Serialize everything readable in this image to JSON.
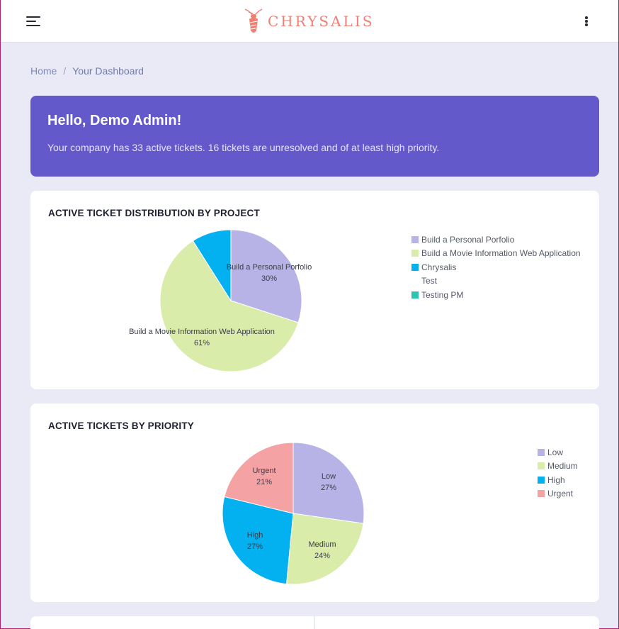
{
  "brand": {
    "name": "CHRYSALIS",
    "accent": "#ef7f72"
  },
  "breadcrumb": {
    "home": "Home",
    "separator": "/",
    "current": "Your Dashboard"
  },
  "hero": {
    "greeting": "Hello, Demo Admin!",
    "message": "Your company has 33 active tickets. 16 tickets are unresolved and of at least high priority."
  },
  "project_chart": {
    "title": "ACTIVE TICKET DISTRIBUTION BY PROJECT",
    "legend": [
      {
        "label": "Build a Personal Porfolio",
        "color": "#b8b3e6"
      },
      {
        "label": "Build a Movie Information Web Application",
        "color": "#d9ecaa"
      },
      {
        "label": "Chrysalis",
        "color": "#03b0f0"
      },
      {
        "label": "Test",
        "color": ""
      },
      {
        "label": "Testing PM",
        "color": "#2ec5b0"
      }
    ]
  },
  "priority_chart": {
    "title": "ACTIVE TICKETS BY PRIORITY",
    "legend": [
      {
        "label": "Low",
        "color": "#b8b3e6"
      },
      {
        "label": "Medium",
        "color": "#d9ecaa"
      },
      {
        "label": "High",
        "color": "#03b0f0"
      },
      {
        "label": "Urgent",
        "color": "#f4a2a4"
      }
    ]
  },
  "chart_data": [
    {
      "type": "pie",
      "title": "ACTIVE TICKET DISTRIBUTION BY PROJECT",
      "categories": [
        "Build a Personal Porfolio",
        "Build a Movie Information Web Application",
        "Chrysalis",
        "Test",
        "Testing PM"
      ],
      "values": [
        30,
        61,
        9,
        0,
        0
      ],
      "labels": [
        "30%",
        "61%",
        "",
        "",
        ""
      ],
      "colors": [
        "#b8b3e6",
        "#d9ecaa",
        "#03b0f0",
        "#ffffff",
        "#2ec5b0"
      ],
      "legend": "right"
    },
    {
      "type": "pie",
      "title": "ACTIVE TICKETS BY PRIORITY",
      "categories": [
        "Low",
        "Medium",
        "High",
        "Urgent"
      ],
      "values": [
        27,
        24,
        27,
        21
      ],
      "labels": [
        "27%",
        "24%",
        "27%",
        "21%"
      ],
      "colors": [
        "#b8b3e6",
        "#d9ecaa",
        "#03b0f0",
        "#f4a2a4"
      ],
      "legend": "right"
    }
  ]
}
